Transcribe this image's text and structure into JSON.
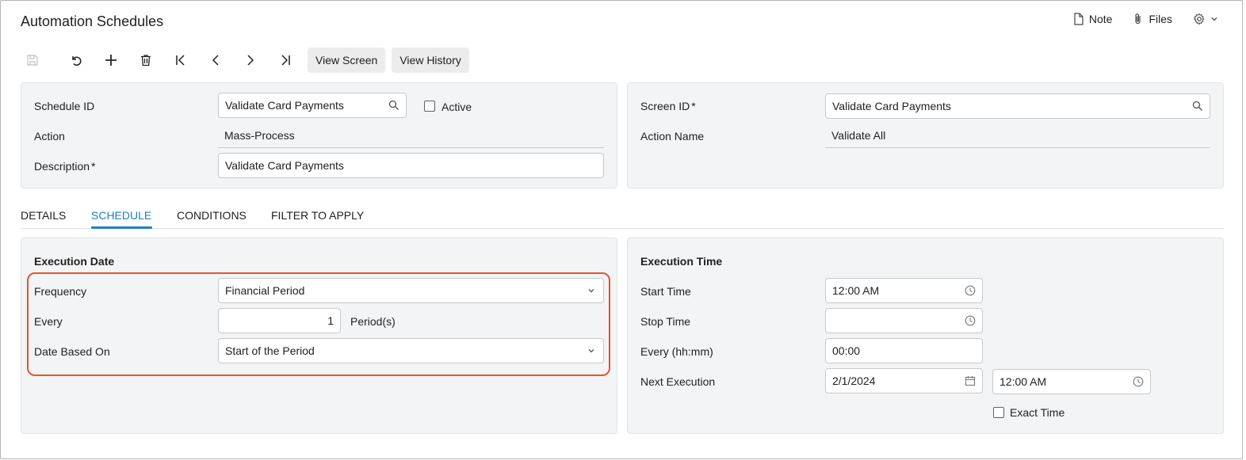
{
  "page": {
    "title": "Automation Schedules"
  },
  "topbar": {
    "note": "Note",
    "files": "Files"
  },
  "toolbar": {
    "view_screen": "View Screen",
    "view_history": "View History"
  },
  "summary": {
    "schedule_id_label": "Schedule ID",
    "schedule_id_value": "Validate Card Payments",
    "active_label": "Active",
    "action_label": "Action",
    "action_value": "Mass-Process",
    "description_label": "Description",
    "description_value": "Validate Card Payments",
    "screen_id_label": "Screen ID",
    "screen_id_value": "Validate Card Payments",
    "action_name_label": "Action Name",
    "action_name_value": "Validate All",
    "required_mark": "*"
  },
  "tabs": [
    {
      "label": "DETAILS"
    },
    {
      "label": "SCHEDULE"
    },
    {
      "label": "CONDITIONS"
    },
    {
      "label": "FILTER TO APPLY"
    }
  ],
  "execution_date": {
    "title": "Execution Date",
    "frequency_label": "Frequency",
    "frequency_value": "Financial Period",
    "every_label": "Every",
    "every_value": "1",
    "every_unit": "Period(s)",
    "date_based_label": "Date Based On",
    "date_based_value": "Start of the Period"
  },
  "execution_time": {
    "title": "Execution Time",
    "start_time_label": "Start Time",
    "start_time_value": "12:00 AM",
    "stop_time_label": "Stop Time",
    "stop_time_value": "",
    "every_label": "Every (hh:mm)",
    "every_value": "00:00",
    "next_exec_label": "Next Execution",
    "next_exec_date": "2/1/2024",
    "next_exec_time": "12:00 AM",
    "exact_time_label": "Exact Time"
  },
  "colors": {
    "accent": "#1e7fc6",
    "highlight": "#e8542b",
    "panel": "#f3f4f5"
  }
}
